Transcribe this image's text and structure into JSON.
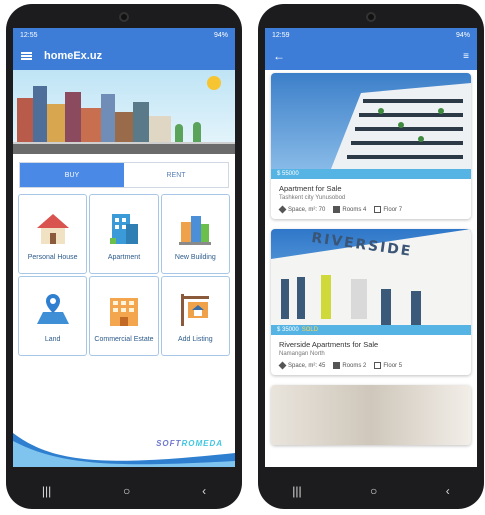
{
  "left_phone": {
    "status": {
      "time": "12:55",
      "battery": "94%"
    },
    "app_title": "homeEx.uz",
    "tabs": [
      {
        "label": "BUY",
        "active": true
      },
      {
        "label": "RENT",
        "active": false
      }
    ],
    "categories": [
      {
        "label": "Personal House",
        "icon": "house-icon"
      },
      {
        "label": "Apartment",
        "icon": "apartment-icon"
      },
      {
        "label": "New Building",
        "icon": "new-building-icon"
      },
      {
        "label": "Land",
        "icon": "land-icon"
      },
      {
        "label": "Commercial Estate",
        "icon": "commercial-estate-icon"
      },
      {
        "label": "Add Listing",
        "icon": "add-listing-icon"
      }
    ],
    "brand": {
      "part1": "SOFT",
      "part2": "ROMEDA"
    }
  },
  "right_phone": {
    "status": {
      "time": "12:59",
      "battery": "94%"
    },
    "listings": [
      {
        "price": "$ 55000",
        "sold": "",
        "title": "Apartment for Sale",
        "location": "Tashkent city Yunusobod",
        "space": "Space, m²: 70",
        "rooms": "Rooms 4",
        "floor": "Floor 7"
      },
      {
        "price": "$ 35000",
        "sold": "SOLD",
        "title": "Riverside Apartments for Sale",
        "location": "Namangan North",
        "space": "Space, m²: 45",
        "rooms": "Rooms 2",
        "floor": "Floor 5",
        "sign": "RIVERSIDE"
      }
    ]
  },
  "colors": {
    "primary": "#3d7dd8",
    "accent": "#4a8ae6",
    "price_bar": "#55b4e3"
  }
}
